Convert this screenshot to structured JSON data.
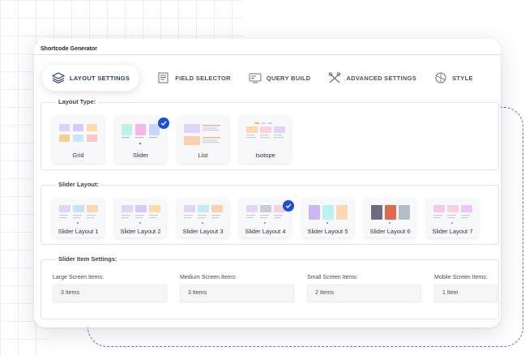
{
  "window": {
    "title": "Shortcode Generator"
  },
  "tabs": [
    {
      "label": "LAYOUT SETTINGS",
      "icon": "layers-icon",
      "active": true
    },
    {
      "label": "FIELD SELECTOR",
      "icon": "field-selector-icon",
      "active": false
    },
    {
      "label": "QUERY BUILD",
      "icon": "query-build-icon",
      "active": false
    },
    {
      "label": "ADVANCED SETTINGS",
      "icon": "tools-icon",
      "active": false
    },
    {
      "label": "STYLE",
      "icon": "style-icon",
      "active": false
    }
  ],
  "layout_type": {
    "title": "Layout Type:",
    "options": [
      {
        "label": "Grid",
        "selected": false
      },
      {
        "label": "Slider",
        "selected": true
      },
      {
        "label": "List",
        "selected": false
      },
      {
        "label": "Isotope",
        "selected": false
      }
    ]
  },
  "slider_layout": {
    "title": "Slider Layout:",
    "options": [
      {
        "label": "Slider Layout 1",
        "selected": false
      },
      {
        "label": "Slider Layout 2",
        "selected": false
      },
      {
        "label": "Slider Layout 3",
        "selected": false
      },
      {
        "label": "Slider Layout 4",
        "selected": true
      },
      {
        "label": "Slider Layout 5",
        "selected": false
      },
      {
        "label": "Slider Layout 6",
        "selected": false
      },
      {
        "label": "Slider Layout 7",
        "selected": false
      }
    ]
  },
  "slider_item_settings": {
    "title": "Slider Item Settings:",
    "fields": [
      {
        "label": "Large Screen Items:",
        "value": "3 Items"
      },
      {
        "label": "Medium Screen Items:",
        "value": "3 Items"
      },
      {
        "label": "Small Screen Items:",
        "value": "2 Items"
      },
      {
        "label": "Mobile Screen Items:",
        "value": "1 Item"
      }
    ]
  },
  "colors": {
    "accent": "#1a4ed8",
    "dashed_frame": "#4b7bd8",
    "grid_lines": "#e9edf7"
  }
}
